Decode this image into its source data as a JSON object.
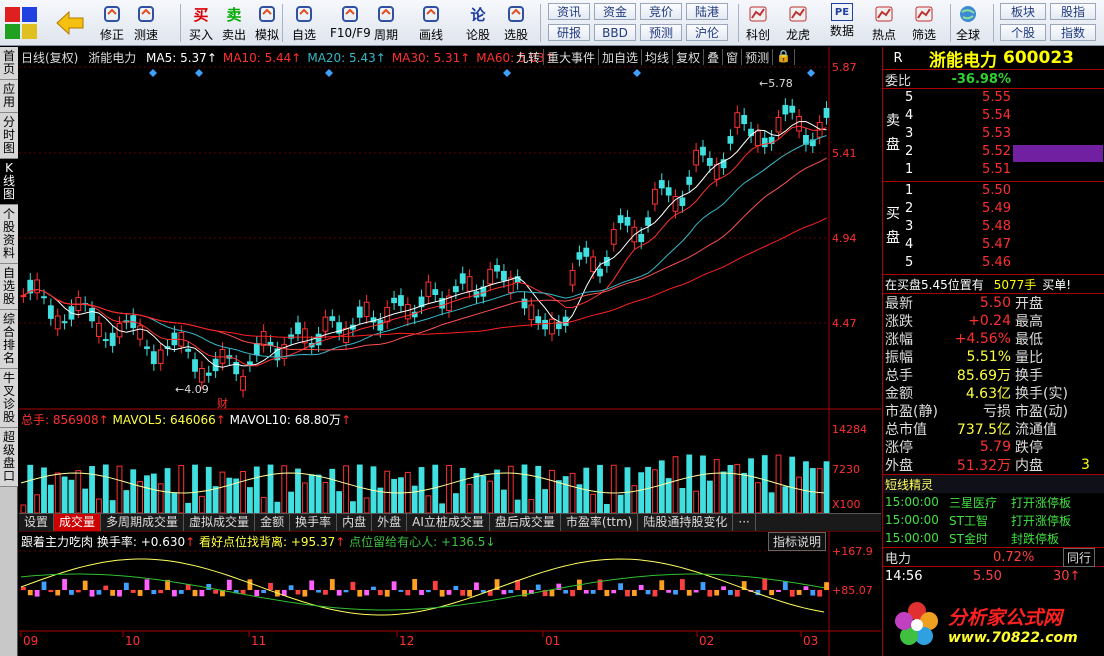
{
  "toolbar": {
    "left_items": [
      {
        "label": "修正",
        "icon": "arrow-up-down-icon"
      },
      {
        "label": "测速",
        "icon": "speed-icon"
      },
      {
        "label": "买入",
        "icon": "buy-icon",
        "glyph": "买"
      },
      {
        "label": "卖出",
        "icon": "sell-icon",
        "glyph": "卖"
      },
      {
        "label": "模拟",
        "icon": "hammer-icon"
      },
      {
        "label": "自选",
        "icon": "watchlist-icon"
      },
      {
        "label": "F10/F9",
        "icon": "f10-icon"
      },
      {
        "label": "周期",
        "icon": "clock-icon"
      },
      {
        "label": "画线",
        "icon": "pencil-icon"
      },
      {
        "label": "论股",
        "icon": "discuss-icon",
        "glyph": "论"
      },
      {
        "label": "选股",
        "icon": "stock-picker-icon"
      }
    ],
    "small_buttons": [
      [
        "资讯",
        "资金",
        "竞价",
        "陆港"
      ],
      [
        "研报",
        "BBD",
        "预测",
        "沪伦"
      ]
    ],
    "right_items": [
      {
        "label": "科创",
        "icon": "kechuang-icon"
      },
      {
        "label": "龙虎",
        "icon": "dragon-icon"
      },
      {
        "label": "数据",
        "icon": "data-icon",
        "glyph": "PE"
      },
      {
        "label": "热点",
        "icon": "hot-icon"
      },
      {
        "label": "筛选",
        "icon": "filter-icon"
      },
      {
        "label": "全球",
        "icon": "globe-icon"
      }
    ],
    "far_right_buttons": [
      [
        "板块",
        "股指"
      ],
      [
        "个股",
        "指数"
      ]
    ]
  },
  "left_tabs": [
    "首页",
    "应用",
    "分时图",
    "K线图",
    "个股资料",
    "自选股",
    "综合排名",
    "牛叉诊股",
    "超级盘口"
  ],
  "kline": {
    "title": "日线(复权)",
    "stock_name": "浙能电力",
    "ma": [
      {
        "label": "MA5: 5.37",
        "color": "#ffffff"
      },
      {
        "label": "MA10: 5.44",
        "color": "#ff3030"
      },
      {
        "label": "MA20: 5.43",
        "color": "#38b8c8"
      },
      {
        "label": "MA30: 5.31",
        "color": "#ff3030"
      },
      {
        "label": "MA60: 5.03",
        "color": "#ff3030"
      }
    ],
    "tools": [
      "九转",
      "重大事件",
      "加自选",
      "均线",
      "复权",
      "叠",
      "窗",
      "预测",
      "🔒"
    ],
    "price_ticks": [
      "5.87",
      "5.41",
      "4.94",
      "4.47"
    ],
    "high_label": "5.78",
    "low_label": "4.09",
    "cai_label": "财"
  },
  "volume": {
    "total": "总手: 856908",
    "mavol5": "MAVOL5: 646066",
    "mavol10": "MAVOL10: 68.80万",
    "ticks": [
      "14284",
      "7230",
      "X100"
    ]
  },
  "indicator_tabs": [
    "设置",
    "成交量",
    "多周期成交量",
    "虚拟成交量",
    "金额",
    "换手率",
    "内盘",
    "外盘",
    "AI立桩成交量",
    "盘后成交量",
    "市盈率(ttm)",
    "陆股通持股变化",
    "···"
  ],
  "indicator": {
    "name": "跟着主力吃肉",
    "v1": "换手率: +0.630",
    "v2": "看好点位找背离: +95.37",
    "v3": "点位留给有心人: +136.5",
    "ticks": [
      "+167.9",
      "+85.07"
    ],
    "explain": "指标说明"
  },
  "xaxis": [
    "09",
    "10",
    "11",
    "12",
    "01",
    "02",
    "03"
  ],
  "quote": {
    "r": "R",
    "name": "浙能电力",
    "code": "600023",
    "weibi_label": "委比",
    "weibi": "-36.98%",
    "sell_side": "卖盘",
    "buy_side": "买盘",
    "sells": [
      {
        "lv": "5",
        "price": "5.55",
        "vol": ""
      },
      {
        "lv": "4",
        "price": "5.54",
        "vol": ""
      },
      {
        "lv": "3",
        "price": "5.53",
        "vol": ""
      },
      {
        "lv": "2",
        "price": "5.52",
        "vol": ""
      },
      {
        "lv": "1",
        "price": "5.51",
        "vol": ""
      }
    ],
    "buys": [
      {
        "lv": "1",
        "price": "5.50",
        "vol": ""
      },
      {
        "lv": "2",
        "price": "5.49",
        "vol": ""
      },
      {
        "lv": "3",
        "price": "5.48",
        "vol": ""
      },
      {
        "lv": "4",
        "price": "5.47",
        "vol": ""
      },
      {
        "lv": "5",
        "price": "5.46",
        "vol": ""
      }
    ],
    "notice": "在买盘5.45位置有",
    "notice_vol": "5077手",
    "notice_tag": "买单!",
    "stats": [
      {
        "k": "最新",
        "v": "5.50",
        "k2": "开盘"
      },
      {
        "k": "涨跌",
        "v": "+0.24",
        "k2": "最高"
      },
      {
        "k": "涨幅",
        "v": "+4.56%",
        "k2": "最低"
      },
      {
        "k": "振幅",
        "v": "5.51%",
        "k2": "量比"
      },
      {
        "k": "总手",
        "v": "85.69万",
        "k2": "换手"
      },
      {
        "k": "金额",
        "v": "4.63亿",
        "k2": "换手(实)"
      },
      {
        "k": "市盈(静)",
        "v": "亏损",
        "k2": "市盈(动)"
      },
      {
        "k": "总市值",
        "v": "737.5亿",
        "k2": "流通值"
      },
      {
        "k": "涨停",
        "v": "5.79",
        "k2": "跌停"
      },
      {
        "k": "外盘",
        "v": "51.32万",
        "k2": "内盘",
        "v2": "3"
      }
    ],
    "short_title": "短线精灵",
    "news": [
      {
        "time": "15:00:00",
        "name": "三星医疗",
        "event": "打开涨停板"
      },
      {
        "time": "15:00:00",
        "name": "ST工智",
        "event": "打开涨停板"
      },
      {
        "time": "15:00:00",
        "name": "ST金时",
        "event": "封跌停板"
      }
    ],
    "sector": "电力",
    "sector_change": "0.72%",
    "sector_tab": "同行",
    "tick_time": "14:56",
    "tick_price": "5.50",
    "tick_vol": "30"
  },
  "watermark": {
    "text1": "分析家公式网",
    "text2": "www.70822.com",
    "bg_text": "分析家公式网www.70822.com"
  }
}
